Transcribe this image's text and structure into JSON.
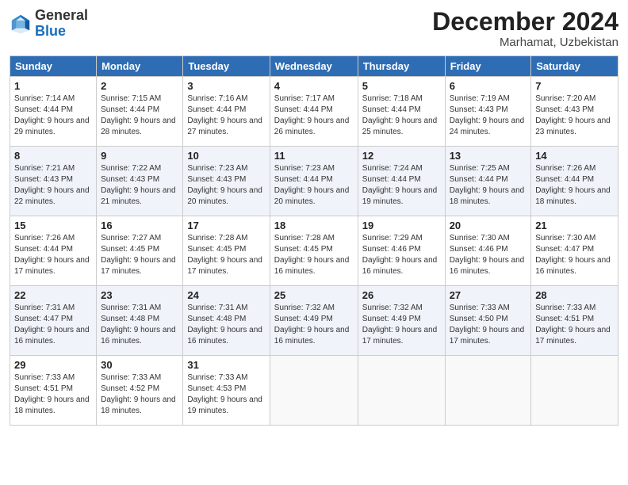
{
  "header": {
    "logo_general": "General",
    "logo_blue": "Blue",
    "month_title": "December 2024",
    "location": "Marhamat, Uzbekistan"
  },
  "weekdays": [
    "Sunday",
    "Monday",
    "Tuesday",
    "Wednesday",
    "Thursday",
    "Friday",
    "Saturday"
  ],
  "weeks": [
    [
      {
        "day": "1",
        "sunrise": "7:14 AM",
        "sunset": "4:44 PM",
        "daylight": "9 hours and 29 minutes."
      },
      {
        "day": "2",
        "sunrise": "7:15 AM",
        "sunset": "4:44 PM",
        "daylight": "9 hours and 28 minutes."
      },
      {
        "day": "3",
        "sunrise": "7:16 AM",
        "sunset": "4:44 PM",
        "daylight": "9 hours and 27 minutes."
      },
      {
        "day": "4",
        "sunrise": "7:17 AM",
        "sunset": "4:44 PM",
        "daylight": "9 hours and 26 minutes."
      },
      {
        "day": "5",
        "sunrise": "7:18 AM",
        "sunset": "4:44 PM",
        "daylight": "9 hours and 25 minutes."
      },
      {
        "day": "6",
        "sunrise": "7:19 AM",
        "sunset": "4:43 PM",
        "daylight": "9 hours and 24 minutes."
      },
      {
        "day": "7",
        "sunrise": "7:20 AM",
        "sunset": "4:43 PM",
        "daylight": "9 hours and 23 minutes."
      }
    ],
    [
      {
        "day": "8",
        "sunrise": "7:21 AM",
        "sunset": "4:43 PM",
        "daylight": "9 hours and 22 minutes."
      },
      {
        "day": "9",
        "sunrise": "7:22 AM",
        "sunset": "4:43 PM",
        "daylight": "9 hours and 21 minutes."
      },
      {
        "day": "10",
        "sunrise": "7:23 AM",
        "sunset": "4:43 PM",
        "daylight": "9 hours and 20 minutes."
      },
      {
        "day": "11",
        "sunrise": "7:23 AM",
        "sunset": "4:44 PM",
        "daylight": "9 hours and 20 minutes."
      },
      {
        "day": "12",
        "sunrise": "7:24 AM",
        "sunset": "4:44 PM",
        "daylight": "9 hours and 19 minutes."
      },
      {
        "day": "13",
        "sunrise": "7:25 AM",
        "sunset": "4:44 PM",
        "daylight": "9 hours and 18 minutes."
      },
      {
        "day": "14",
        "sunrise": "7:26 AM",
        "sunset": "4:44 PM",
        "daylight": "9 hours and 18 minutes."
      }
    ],
    [
      {
        "day": "15",
        "sunrise": "7:26 AM",
        "sunset": "4:44 PM",
        "daylight": "9 hours and 17 minutes."
      },
      {
        "day": "16",
        "sunrise": "7:27 AM",
        "sunset": "4:45 PM",
        "daylight": "9 hours and 17 minutes."
      },
      {
        "day": "17",
        "sunrise": "7:28 AM",
        "sunset": "4:45 PM",
        "daylight": "9 hours and 17 minutes."
      },
      {
        "day": "18",
        "sunrise": "7:28 AM",
        "sunset": "4:45 PM",
        "daylight": "9 hours and 16 minutes."
      },
      {
        "day": "19",
        "sunrise": "7:29 AM",
        "sunset": "4:46 PM",
        "daylight": "9 hours and 16 minutes."
      },
      {
        "day": "20",
        "sunrise": "7:30 AM",
        "sunset": "4:46 PM",
        "daylight": "9 hours and 16 minutes."
      },
      {
        "day": "21",
        "sunrise": "7:30 AM",
        "sunset": "4:47 PM",
        "daylight": "9 hours and 16 minutes."
      }
    ],
    [
      {
        "day": "22",
        "sunrise": "7:31 AM",
        "sunset": "4:47 PM",
        "daylight": "9 hours and 16 minutes."
      },
      {
        "day": "23",
        "sunrise": "7:31 AM",
        "sunset": "4:48 PM",
        "daylight": "9 hours and 16 minutes."
      },
      {
        "day": "24",
        "sunrise": "7:31 AM",
        "sunset": "4:48 PM",
        "daylight": "9 hours and 16 minutes."
      },
      {
        "day": "25",
        "sunrise": "7:32 AM",
        "sunset": "4:49 PM",
        "daylight": "9 hours and 16 minutes."
      },
      {
        "day": "26",
        "sunrise": "7:32 AM",
        "sunset": "4:49 PM",
        "daylight": "9 hours and 17 minutes."
      },
      {
        "day": "27",
        "sunrise": "7:33 AM",
        "sunset": "4:50 PM",
        "daylight": "9 hours and 17 minutes."
      },
      {
        "day": "28",
        "sunrise": "7:33 AM",
        "sunset": "4:51 PM",
        "daylight": "9 hours and 17 minutes."
      }
    ],
    [
      {
        "day": "29",
        "sunrise": "7:33 AM",
        "sunset": "4:51 PM",
        "daylight": "9 hours and 18 minutes."
      },
      {
        "day": "30",
        "sunrise": "7:33 AM",
        "sunset": "4:52 PM",
        "daylight": "9 hours and 18 minutes."
      },
      {
        "day": "31",
        "sunrise": "7:33 AM",
        "sunset": "4:53 PM",
        "daylight": "9 hours and 19 minutes."
      },
      null,
      null,
      null,
      null
    ]
  ]
}
